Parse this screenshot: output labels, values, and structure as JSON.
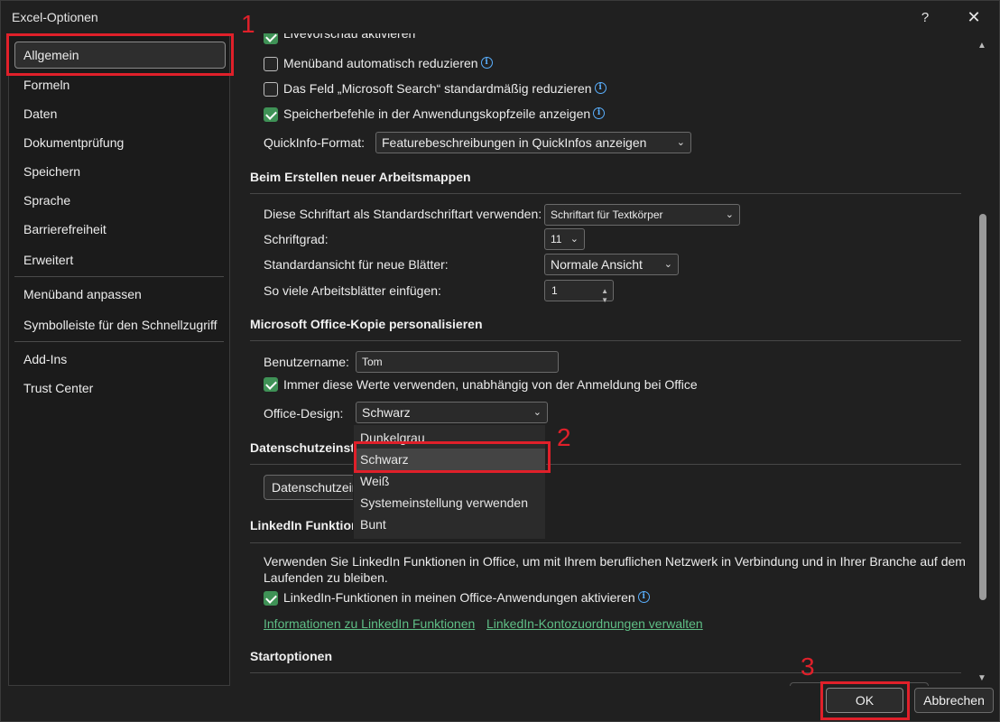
{
  "window": {
    "title": "Excel-Optionen",
    "help": "?",
    "close": "✕"
  },
  "sidebar": {
    "items": [
      {
        "label": "Allgemein"
      },
      {
        "label": "Formeln"
      },
      {
        "label": "Daten"
      },
      {
        "label": "Dokumentprüfung"
      },
      {
        "label": "Speichern"
      },
      {
        "label": "Sprache"
      },
      {
        "label": "Barrierefreiheit"
      },
      {
        "label": "Erweitert"
      },
      {
        "label": "Menüband anpassen"
      },
      {
        "label": "Symbolleiste für den Schnellzugriff"
      },
      {
        "label": "Add-Ins"
      },
      {
        "label": "Trust Center"
      }
    ]
  },
  "ui_options": {
    "live_preview": {
      "label": "Livevorschau aktivieren",
      "checked": true
    },
    "collapse_ribbon": {
      "label": "Menüband automatisch reduzieren",
      "checked": false
    },
    "search_collapse": {
      "label": "Das Feld „Microsoft Search“ standardmäßig reduzieren",
      "checked": false
    },
    "save_commands": {
      "label": "Speicherbefehle in der Anwendungskopfzeile anzeigen",
      "checked": true
    },
    "screentip_label": "QuickInfo-Format:",
    "screentip_value": "Featurebeschreibungen in QuickInfos anzeigen"
  },
  "new_workbooks": {
    "heading": "Beim Erstellen neuer Arbeitsmappen",
    "font_label": "Diese Schriftart als Standardschriftart verwenden:",
    "font_value": "Schriftart für Textkörper",
    "size_label": "Schriftgrad:",
    "size_value": "11",
    "view_label": "Standardansicht für neue Blätter:",
    "view_value": "Normale Ansicht",
    "sheets_label": "So viele Arbeitsblätter einfügen:",
    "sheets_value": "1"
  },
  "personalize": {
    "heading": "Microsoft Office-Kopie personalisieren",
    "username_label": "Benutzername:",
    "username_value": "Tom",
    "always_use": {
      "label": "Immer diese Werte verwenden, unabhängig von der Anmeldung bei Office",
      "checked": true
    },
    "theme_label": "Office-Design:",
    "theme_value": "Schwarz",
    "theme_options": [
      "Dunkelgrau",
      "Schwarz",
      "Weiß",
      "Systemeinstellung verwenden",
      "Bunt"
    ],
    "theme_highlighted": "Schwarz"
  },
  "privacy": {
    "heading": "Datenschutzeinst",
    "button": "Datenschutzein"
  },
  "linkedin": {
    "heading": "LinkedIn Funktion",
    "description_line1": "Verwenden Sie LinkedIn Funktionen in Office, um mit Ihrem beruflichen Netzwerk in Verbindung und in Ihrer Branche auf dem",
    "description_line2": "Laufenden zu bleiben.",
    "enable": {
      "label": "LinkedIn-Funktionen in meinen Office-Anwendungen aktivieren",
      "checked": true
    },
    "link1": "Informationen zu LinkedIn Funktionen",
    "link2": "LinkedIn-Kontozuordnungen verwalten"
  },
  "startup": {
    "heading": "Startoptionen"
  },
  "footer": {
    "ok": "OK",
    "cancel": "Abbrechen"
  },
  "annotations": [
    "1",
    "2",
    "3"
  ],
  "colors": {
    "accent_green": "#3f9256",
    "annotation_red": "#e0202a",
    "link": "#5fbf86",
    "info_blue": "#5ab0ff"
  }
}
